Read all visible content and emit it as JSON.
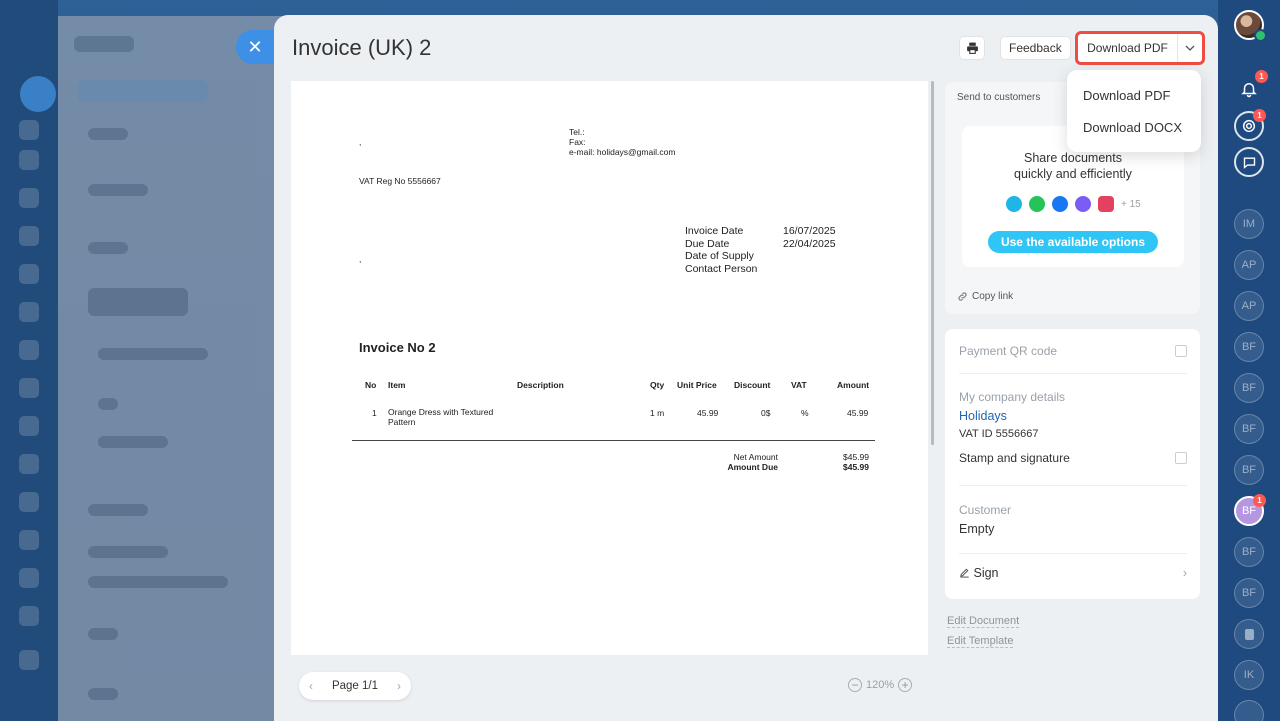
{
  "title": "Invoice (UK) 2",
  "toolbar": {
    "feedback_label": "Feedback",
    "download_label": "Download PDF"
  },
  "download_menu": {
    "items": [
      "Download PDF",
      "Download DOCX"
    ]
  },
  "document": {
    "company_comma_1": ",",
    "tel_label": "Tel.:",
    "fax_label": "Fax:",
    "email_line": "e-mail: holidays@gmail.com",
    "vat_reg": "VAT Reg No 5556667",
    "client_comma": ",",
    "meta": [
      {
        "label": "Invoice Date",
        "value": "16/07/2025"
      },
      {
        "label": "Due Date",
        "value": "22/04/2025"
      },
      {
        "label": "Date of Supply",
        "value": ""
      },
      {
        "label": "Contact Person",
        "value": ""
      }
    ],
    "invoice_heading": "Invoice No 2",
    "columns": [
      "No",
      "Item",
      "Description",
      "Qty",
      "Unit Price",
      "Discount",
      "VAT",
      "Amount"
    ],
    "rows": [
      {
        "no": "1",
        "item_line1": "Orange Dress with Textured",
        "item_line2": "Pattern",
        "description": "",
        "qty": "1 m",
        "unit_price": "45.99",
        "discount": "0$",
        "vat": "%",
        "amount": "45.99"
      }
    ],
    "net_amount_label": "Net Amount",
    "net_amount_value": "$45.99",
    "amount_due_label": "Amount Due",
    "amount_due_value": "$45.99"
  },
  "pager": {
    "label": "Page 1/1"
  },
  "zoom": {
    "level": "120%"
  },
  "send": {
    "title": "Send to customers",
    "share_line1": "Share documents",
    "share_line2": "quickly and efficiently",
    "more_count": "+ 15",
    "use_button": "Use the available options",
    "copy_link": "Copy link"
  },
  "details": {
    "qr_label": "Payment QR code",
    "company_label": "My company details",
    "company_name": "Holidays",
    "vat_id": "VAT ID 5556667",
    "stamp_label": "Stamp and signature",
    "customer_label": "Customer",
    "customer_value": "Empty",
    "sign_label": "Sign"
  },
  "links": {
    "edit_document": "Edit Document",
    "edit_template": "Edit Template"
  },
  "right_bar": {
    "bell_badge": "1",
    "target_badge": "1",
    "avatars": [
      "IM",
      "AP",
      "AP",
      "BF",
      "BF",
      "BF",
      "BF",
      "BF",
      "BF",
      "BF",
      "IK"
    ],
    "active_avatar_badge": "1"
  },
  "colors": {
    "accent_blue": "#3e8fe6",
    "highlight_red": "#ef4d43",
    "share_button": "#2fc6f6",
    "link_blue": "#2067b0"
  }
}
